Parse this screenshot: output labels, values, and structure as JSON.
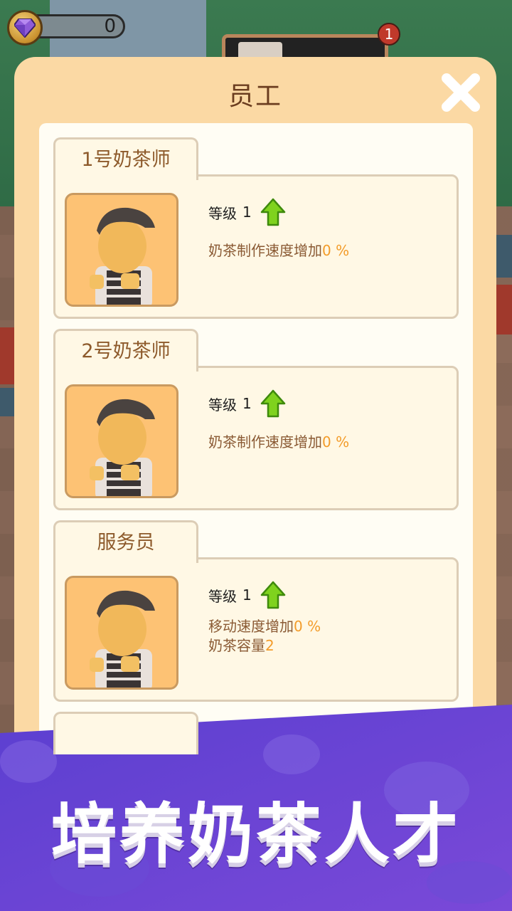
{
  "hud": {
    "gem_count": "0",
    "notification_count": "1"
  },
  "dialog": {
    "title": "员工",
    "employees": [
      {
        "name": "1号奶茶师",
        "level_label": "等级",
        "level": "1",
        "stats": [
          {
            "label": "奶茶制作速度增加",
            "value": "0 %"
          }
        ]
      },
      {
        "name": "2号奶茶师",
        "level_label": "等级",
        "level": "1",
        "stats": [
          {
            "label": "奶茶制作速度增加",
            "value": "0 %"
          }
        ]
      },
      {
        "name": "服务员",
        "level_label": "等级",
        "level": "1",
        "stats": [
          {
            "label": "移动速度增加",
            "value": "0 %"
          },
          {
            "label": "奶茶容量",
            "value": "2"
          }
        ]
      }
    ]
  },
  "banner": {
    "text": "培养奶茶人才"
  },
  "colors": {
    "panel": "#fbd9a4",
    "accent_orange": "#f39c2a",
    "banner_purple": "#6b45d6",
    "upgrade_green": "#7fd21e"
  },
  "icons": {
    "gem": "gem-icon",
    "close": "close-icon",
    "upgrade": "upgrade-arrow-icon"
  }
}
